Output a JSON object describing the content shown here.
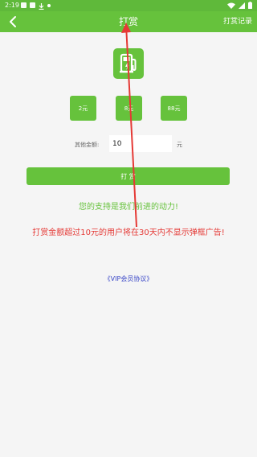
{
  "status_bar": {
    "time": "2:19"
  },
  "header": {
    "title": "打赏",
    "record_label": "打赏记录"
  },
  "amounts": [
    {
      "label": "2元"
    },
    {
      "label": "8元"
    },
    {
      "label": "88元"
    }
  ],
  "other_amount": {
    "label": "其他金额:",
    "value": "10",
    "unit": "元"
  },
  "reward_button": {
    "label": "打 赏"
  },
  "messages": {
    "support": "您的支持是我们前进的动力!",
    "notice": "打赏金额超过10元的用户将在30天内不显示弹框广告!"
  },
  "vip_link": "《VIP会员协议》",
  "colors": {
    "primary": "#66c23c",
    "notice": "#e53935",
    "link": "#3b48c8",
    "annotation": "#e53935"
  }
}
